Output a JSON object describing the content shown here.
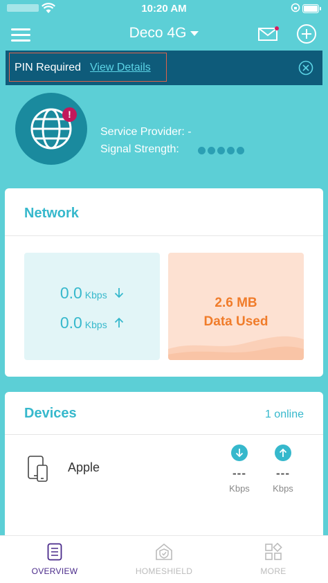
{
  "status_bar": {
    "time": "10:20 AM"
  },
  "header": {
    "title": "Deco 4G"
  },
  "pin_banner": {
    "message": "PIN Required",
    "link": "View Details"
  },
  "internet": {
    "alert_glyph": "!",
    "service_provider_label": "Service Provider: -",
    "signal_strength_label": "Signal Strength:",
    "signal_bars_active": 0,
    "signal_bars_total": 5
  },
  "network": {
    "title": "Network",
    "download": {
      "value": "0.0",
      "unit": "Kbps"
    },
    "upload": {
      "value": "0.0",
      "unit": "Kbps"
    },
    "data_used_amount": "2.6 MB",
    "data_used_label": "Data Used"
  },
  "devices": {
    "title": "Devices",
    "online": "1 online",
    "items": [
      {
        "name": "Apple",
        "download_value": "---",
        "download_unit": "Kbps",
        "upload_value": "---",
        "upload_unit": "Kbps"
      }
    ]
  },
  "tabbar": {
    "overview": "OVERVIEW",
    "homeshield": "HOMESHIELD",
    "more": "MORE"
  },
  "colors": {
    "background": "#5ccfd6",
    "banner": "#0e5b7a",
    "accent": "#36b8cc",
    "data_orange": "#f07c2a",
    "alert": "#c2185b",
    "active_tab": "#4a2a8a"
  }
}
